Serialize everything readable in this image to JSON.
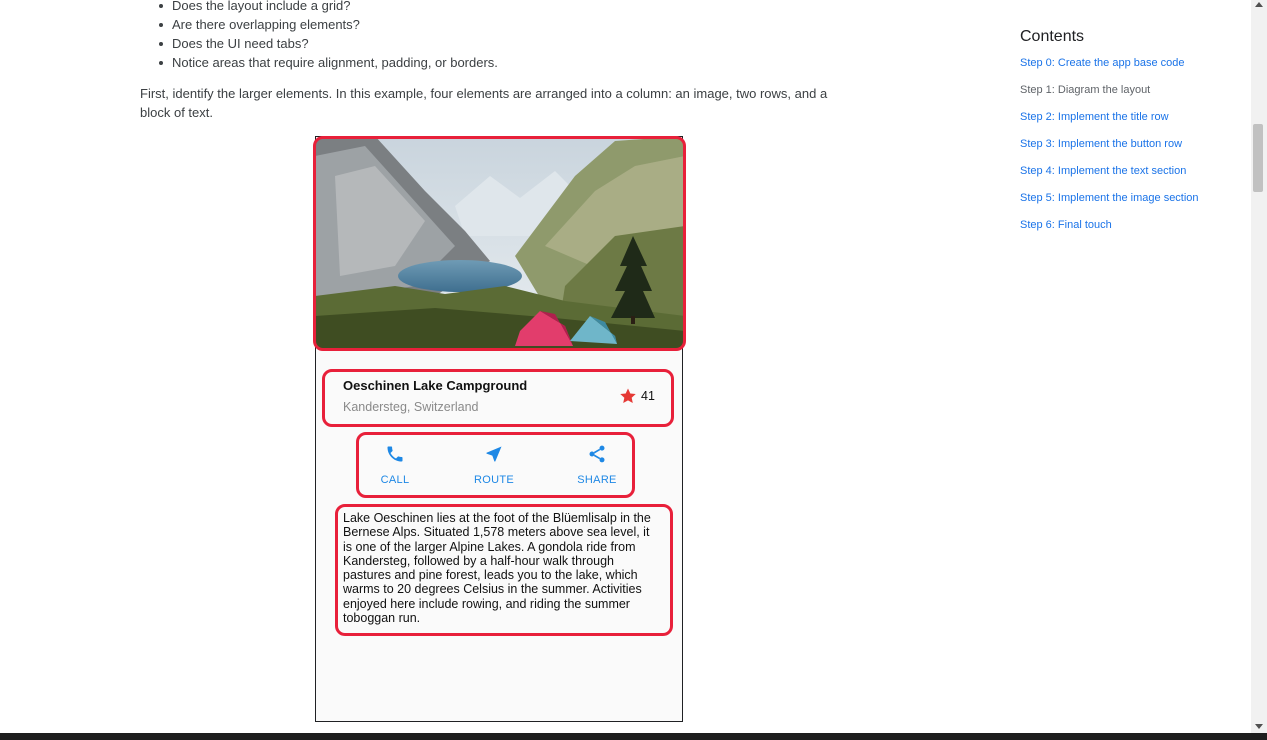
{
  "article": {
    "bullets": [
      "Does the layout include a grid?",
      "Are there overlapping elements?",
      "Does the UI need tabs?",
      "Notice areas that require alignment, padding, or borders."
    ],
    "paragraph": "First, identify the larger elements. In this example, four elements are arranged into a column: an image, two rows, and a block of text."
  },
  "mockup": {
    "image_alt": "lake-mountain-campground-photo",
    "title": "Oeschinen Lake Campground",
    "location": "Kandersteg, Switzerland",
    "rating_count": "41",
    "buttons": [
      {
        "label": "CALL",
        "icon": "phone-icon"
      },
      {
        "label": "ROUTE",
        "icon": "navigation-icon"
      },
      {
        "label": "SHARE",
        "icon": "share-icon"
      }
    ],
    "description": "Lake Oeschinen lies at the foot of the Blüemlisalp in the Bernese Alps. Situated 1,578 meters above sea level, it is one of the larger Alpine Lakes. A gondola ride from Kandersteg, followed by a half-hour walk through pastures and pine forest, leads you to the lake, which warms to 20 degrees Celsius in the summer. Activities enjoyed here include rowing, and riding the summer toboggan run.",
    "highlight_color": "#e8203a",
    "accent_color": "#1e88e5"
  },
  "sidebar": {
    "title": "Contents",
    "items": [
      "Step 0: Create the app base code",
      "Step 1: Diagram the layout",
      "Step 2: Implement the title row",
      "Step 3: Implement the button row",
      "Step 4: Implement the text section",
      "Step 5: Implement the image section",
      "Step 6: Final touch"
    ]
  }
}
